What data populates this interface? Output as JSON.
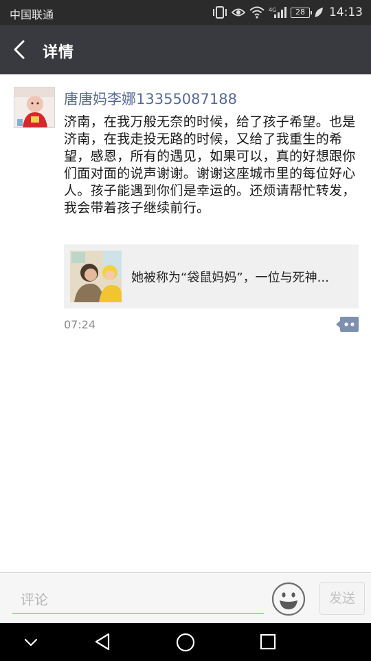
{
  "status_bar": {
    "carrier": "中国联通",
    "battery": "28",
    "time": "14:13",
    "icons": [
      "vibrate-icon",
      "eye-icon",
      "wifi-icon",
      "signal-4g-icon",
      "battery-icon",
      "leaf-icon"
    ]
  },
  "header": {
    "title": "详情",
    "back_icon": "chevron-left-icon"
  },
  "post": {
    "author": "唐唐妈李娜13355087188",
    "text": "济南，在我万般无奈的时候，给了孩子希望。也是济南，在我走投无路的时候，又给了我重生的希望，感恩，所有的遇见，如果可以，真的好想跟你们面对面的说声谢谢。谢谢这座城市里的每位好心人。孩子能遇到你们是幸运的。还烦请帮忙转发，我会带着孩子继续前行。",
    "link_title": "她被称为“袋鼠妈妈”，一位与死神...",
    "time": "07:24",
    "comment_icon": "comment-bubble-icon"
  },
  "comment_bar": {
    "placeholder": "评论",
    "emoji_icon": "smiley-icon",
    "send_label": "发送",
    "accent_color": "#45c01a"
  },
  "colors": {
    "header_bg": "#393a3f",
    "author_name": "#576b95",
    "comment_icon": "#7d90b0"
  },
  "nav_bar": {
    "icons": [
      "chevron-down-icon",
      "back-triangle-icon",
      "home-circle-icon",
      "recents-square-icon"
    ]
  }
}
